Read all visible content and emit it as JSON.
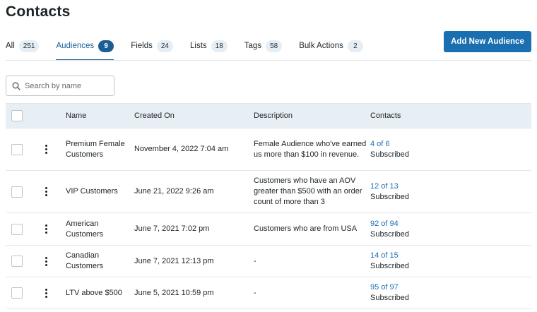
{
  "page": {
    "title": "Contacts"
  },
  "tabs": [
    {
      "label": "All",
      "count": "251",
      "active": false
    },
    {
      "label": "Audiences",
      "count": "9",
      "active": true
    },
    {
      "label": "Fields",
      "count": "24",
      "active": false
    },
    {
      "label": "Lists",
      "count": "18",
      "active": false
    },
    {
      "label": "Tags",
      "count": "58",
      "active": false
    },
    {
      "label": "Bulk Actions",
      "count": "2",
      "active": false
    }
  ],
  "toolbar": {
    "add_label": "Add New Audience"
  },
  "search": {
    "placeholder": "Search by name",
    "value": "",
    "icon": "search-icon"
  },
  "table": {
    "columns": {
      "name": "Name",
      "created": "Created On",
      "description": "Description",
      "contacts": "Contacts"
    },
    "rows": [
      {
        "name": "Premium Female Customers",
        "created": "November 4, 2022 7:04 am",
        "description": "Female Audience who've earned us more than $100 in revenue.",
        "contacts_link": "4 of 6",
        "contacts_status": "Subscribed"
      },
      {
        "name": "VIP Customers",
        "created": "June 21, 2022 9:26 am",
        "description": "Customers who have an AOV greater than $500 with an order count of more than 3",
        "contacts_link": "12 of 13",
        "contacts_status": "Subscribed"
      },
      {
        "name": "American Customers",
        "created": "June 7, 2021 7:02 pm",
        "description": "Customers who are from USA",
        "contacts_link": "92 of 94",
        "contacts_status": "Subscribed"
      },
      {
        "name": "Canadian Customers",
        "created": "June 7, 2021 12:13 pm",
        "description": "-",
        "contacts_link": "14 of 15",
        "contacts_status": "Subscribed"
      },
      {
        "name": "LTV above $500",
        "created": "June 5, 2021 10:59 pm",
        "description": "-",
        "contacts_link": "95 of 97",
        "contacts_status": "Subscribed"
      }
    ]
  },
  "colors": {
    "accent": "#1d5d96",
    "button": "#1a6fb0",
    "link": "#1d6fb5",
    "header_bg": "#e8eff4"
  }
}
